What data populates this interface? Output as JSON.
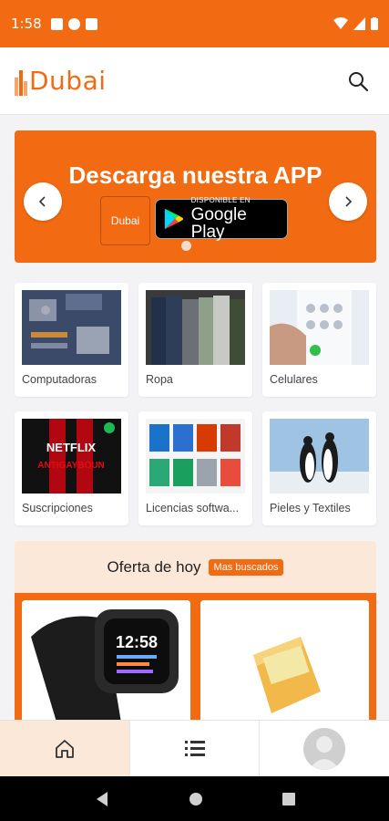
{
  "status_bar": {
    "time": "1:58"
  },
  "header": {
    "logo_text": "Dubai"
  },
  "banner": {
    "title": "Descarga nuestra APP",
    "logo_box_text": "Dubai",
    "store_small": "DISPONIBLE EN",
    "store_big": "Google Play"
  },
  "categories": [
    {
      "label": "Computadoras"
    },
    {
      "label": "Ropa"
    },
    {
      "label": "Celulares"
    },
    {
      "label": "Suscripciones"
    },
    {
      "label": "Licencias softwa..."
    },
    {
      "label": "Pieles y Textiles"
    }
  ],
  "netflix_img": {
    "line1": "NETFLIX",
    "line2": "ANTIGAYBOUN"
  },
  "product_images": {
    "watch_time": "12:58"
  },
  "offer": {
    "title": "Oferta de hoy",
    "badge": "Mas buscados"
  },
  "colors": {
    "accent": "#f26b12",
    "accent_light": "#fce8d9"
  },
  "bottom_nav": [
    "home-icon",
    "list-icon",
    "avatar"
  ]
}
